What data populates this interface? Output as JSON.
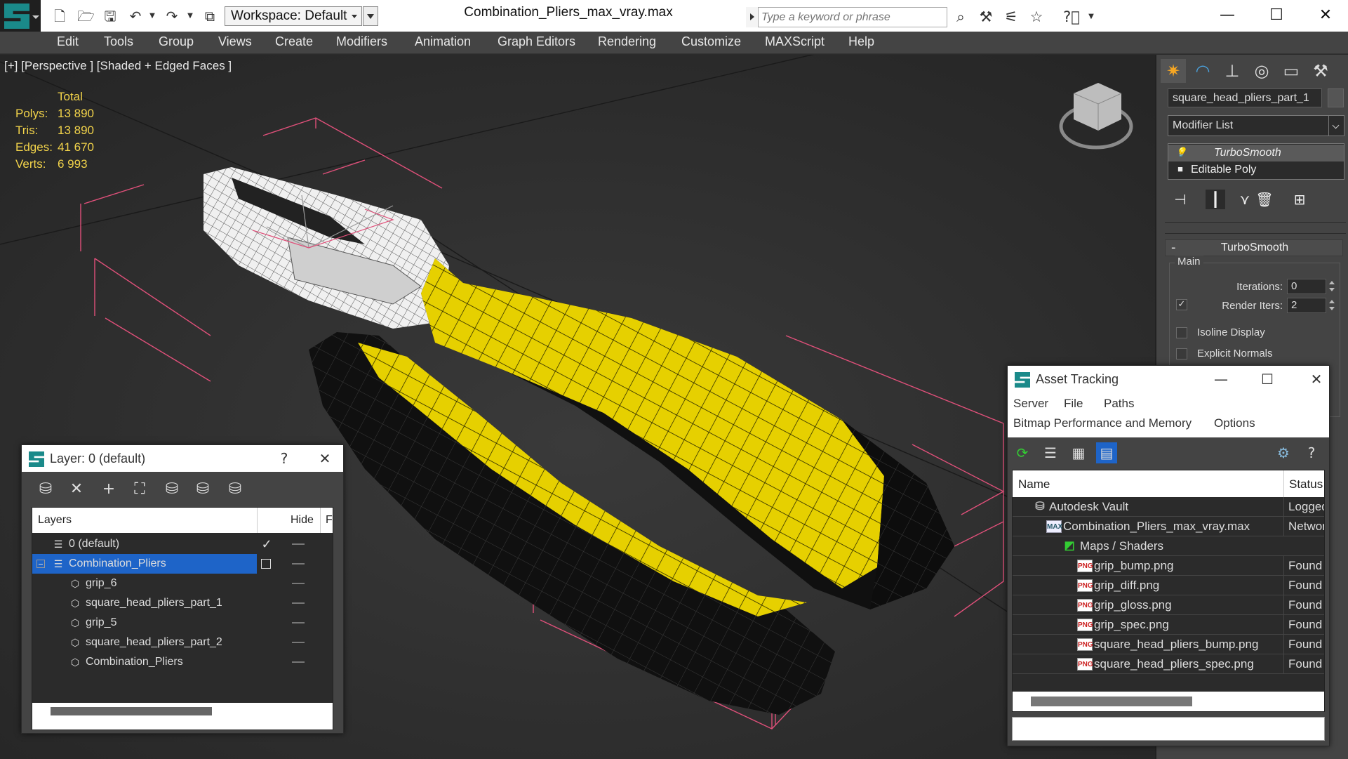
{
  "app": {
    "document_title": "Combination_Pliers_max_vray.max",
    "workspace": "Workspace: Default",
    "search_placeholder": "Type a keyword or phrase"
  },
  "menu": [
    "Edit",
    "Tools",
    "Group",
    "Views",
    "Create",
    "Modifiers",
    "Animation",
    "Graph Editors",
    "Rendering",
    "Customize",
    "MAXScript",
    "Help"
  ],
  "viewport": {
    "label": "[+] [Perspective ] [Shaded + Edged Faces ]",
    "stats": {
      "header": "Total",
      "rows": [
        {
          "key": "Polys:",
          "value": "13 890"
        },
        {
          "key": "Tris:",
          "value": "13 890"
        },
        {
          "key": "Edges:",
          "value": "41 670"
        },
        {
          "key": "Verts:",
          "value": "6 993"
        }
      ]
    }
  },
  "command_panel": {
    "object_name": "square_head_pliers_part_1",
    "modifier_list": "Modifier List",
    "stack": [
      "TurboSmooth",
      "Editable Poly"
    ],
    "rollout_title": "TurboSmooth",
    "group_label": "Main",
    "iterations_label": "Iterations:",
    "iterations_value": "0",
    "render_iters_label": "Render Iters:",
    "render_iters_value": "2",
    "isoline_label": "Isoline Display",
    "explicit_normals_label": "Explicit Normals"
  },
  "layer_window": {
    "title": "Layer: 0 (default)",
    "help": "?",
    "columns": [
      "Layers",
      "Hide",
      "F"
    ],
    "rows": [
      {
        "name": "0 (default)"
      },
      {
        "name": "Combination_Pliers"
      },
      {
        "name": "grip_6"
      },
      {
        "name": "square_head_pliers_part_1"
      },
      {
        "name": "grip_5"
      },
      {
        "name": "square_head_pliers_part_2"
      },
      {
        "name": "Combination_Pliers"
      }
    ]
  },
  "asset_window": {
    "title": "Asset Tracking",
    "menu_row1": [
      "Server",
      "File",
      "Paths"
    ],
    "menu_row2": [
      "Bitmap Performance and Memory",
      "Options"
    ],
    "columns": [
      "Name",
      "Status"
    ],
    "rows": [
      {
        "name": "Autodesk Vault",
        "status": "Logged"
      },
      {
        "name": "Combination_Pliers_max_vray.max",
        "status": "Networ"
      },
      {
        "name": "Maps / Shaders",
        "status": ""
      },
      {
        "name": "grip_bump.png",
        "status": "Found"
      },
      {
        "name": "grip_diff.png",
        "status": "Found"
      },
      {
        "name": "grip_gloss.png",
        "status": "Found"
      },
      {
        "name": "grip_spec.png",
        "status": "Found"
      },
      {
        "name": "square_head_pliers_bump.png",
        "status": "Found"
      },
      {
        "name": "square_head_pliers_spec.png",
        "status": "Found"
      }
    ],
    "icon_png": "PNG",
    "icon_max": "MAX"
  },
  "colors": {
    "accent": "#1e64c8",
    "stats_text": "#f2d34a",
    "grip_yellow": "#e6d000",
    "selection_bbox": "#e0507a"
  }
}
